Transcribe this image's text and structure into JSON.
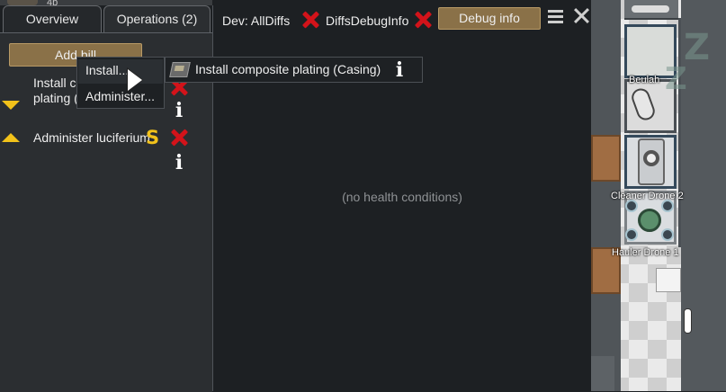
{
  "left_panel": {
    "tabs": [
      {
        "label": "Overview"
      },
      {
        "label": "Operations (2)"
      }
    ],
    "add_bill_label": "Add bill",
    "bills": [
      {
        "label_line1": "Install c",
        "label_line2": "plating (",
        "direction": "down"
      },
      {
        "label": "Administer luciferium",
        "direction": "up"
      }
    ],
    "context_menu": {
      "items": [
        "Install...",
        "Administer..."
      ]
    },
    "submenu": {
      "item_label": "Install composite plating (Casing)"
    }
  },
  "main_panel": {
    "dev_label": "Dev: AllDiffs",
    "diffs_label": "DiffsDebugInfo",
    "debug_button_label": "Debug info",
    "empty_message": "(no health conditions)"
  },
  "map": {
    "pawn_label": "Beulah",
    "drone_labels": [
      "Cleaner Drone 2",
      "Hauler Drone 1"
    ],
    "sleep_glyph": "Z"
  },
  "top_strip": {
    "cut_text": "4b"
  },
  "colors": {
    "panel_bg": "#2b2e31",
    "main_bg": "#1d2023",
    "button_tan": "#8a7148",
    "delete_red": "#d3131a",
    "priority_yellow": "#f2c21a"
  },
  "icons": {
    "delete": "x-icon",
    "info": "info-icon",
    "suspend": "dollar-icon",
    "menu": "hamburger-icon",
    "close": "close-icon"
  }
}
